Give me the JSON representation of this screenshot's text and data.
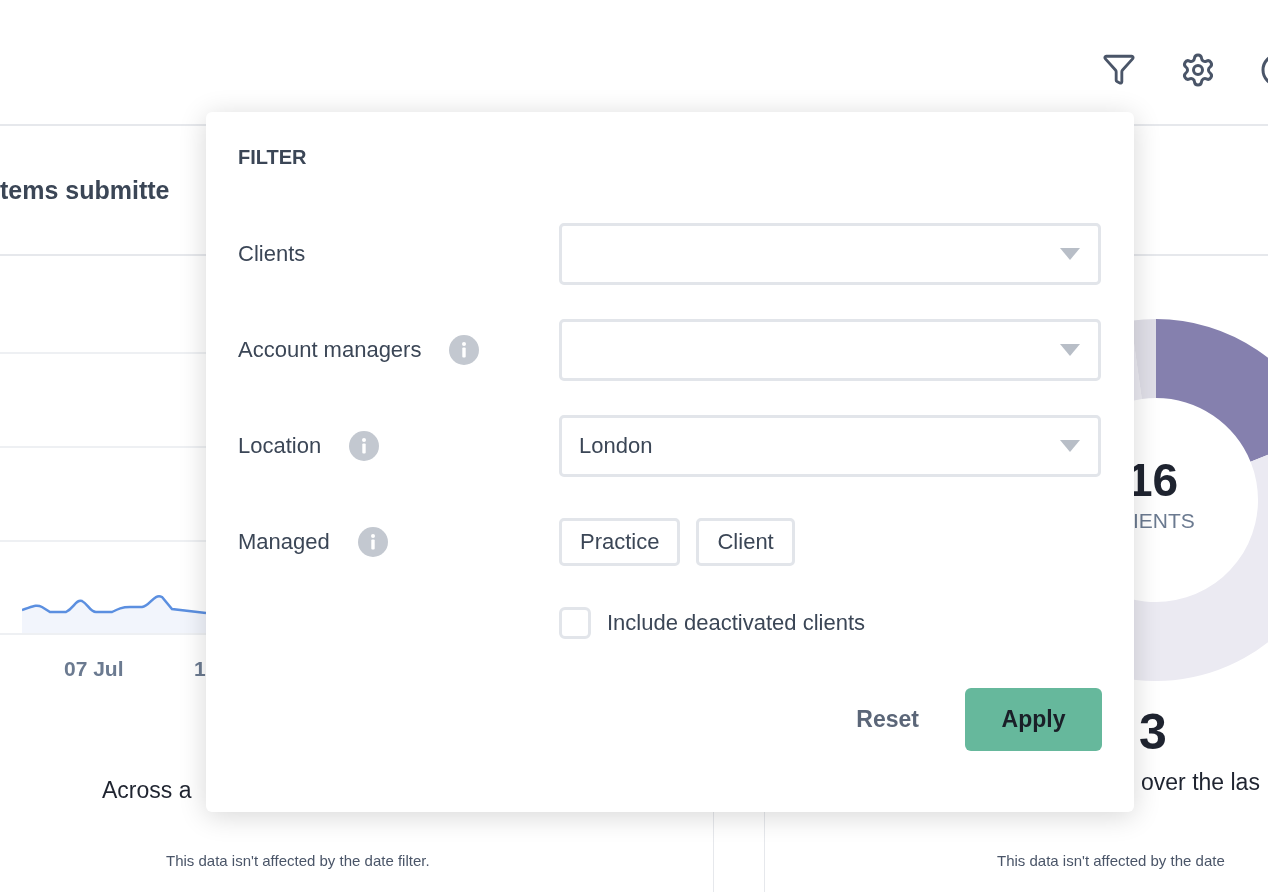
{
  "left_card": {
    "title": "tems submitte",
    "x_ticks": [
      "07 Jul",
      "1"
    ],
    "summary": "Across a",
    "note": "This data isn't affected by the date filter."
  },
  "right_card": {
    "donut_value": "16",
    "donut_label": "IENTS",
    "stat_value": "3",
    "stat_text": "over the las",
    "note": "This data isn't affected by the date"
  },
  "filter_panel": {
    "title": "FILTER",
    "fields": [
      {
        "kind": "dropdown",
        "label": "Clients",
        "info": false
      },
      {
        "kind": "dropdown",
        "label": "Account managers",
        "info": true
      },
      {
        "kind": "dropdown",
        "label": "Location",
        "info": true,
        "value": "London"
      },
      {
        "kind": "toggles",
        "label": "Managed",
        "info": true,
        "options": [
          {
            "label": "Practice",
            "selected": false
          },
          {
            "label": "Client",
            "selected": false
          }
        ]
      }
    ],
    "checkbox": {
      "label": "Include deactivated clients",
      "checked": false
    },
    "buttons": {
      "reset": "Reset",
      "apply": "Apply"
    }
  }
}
